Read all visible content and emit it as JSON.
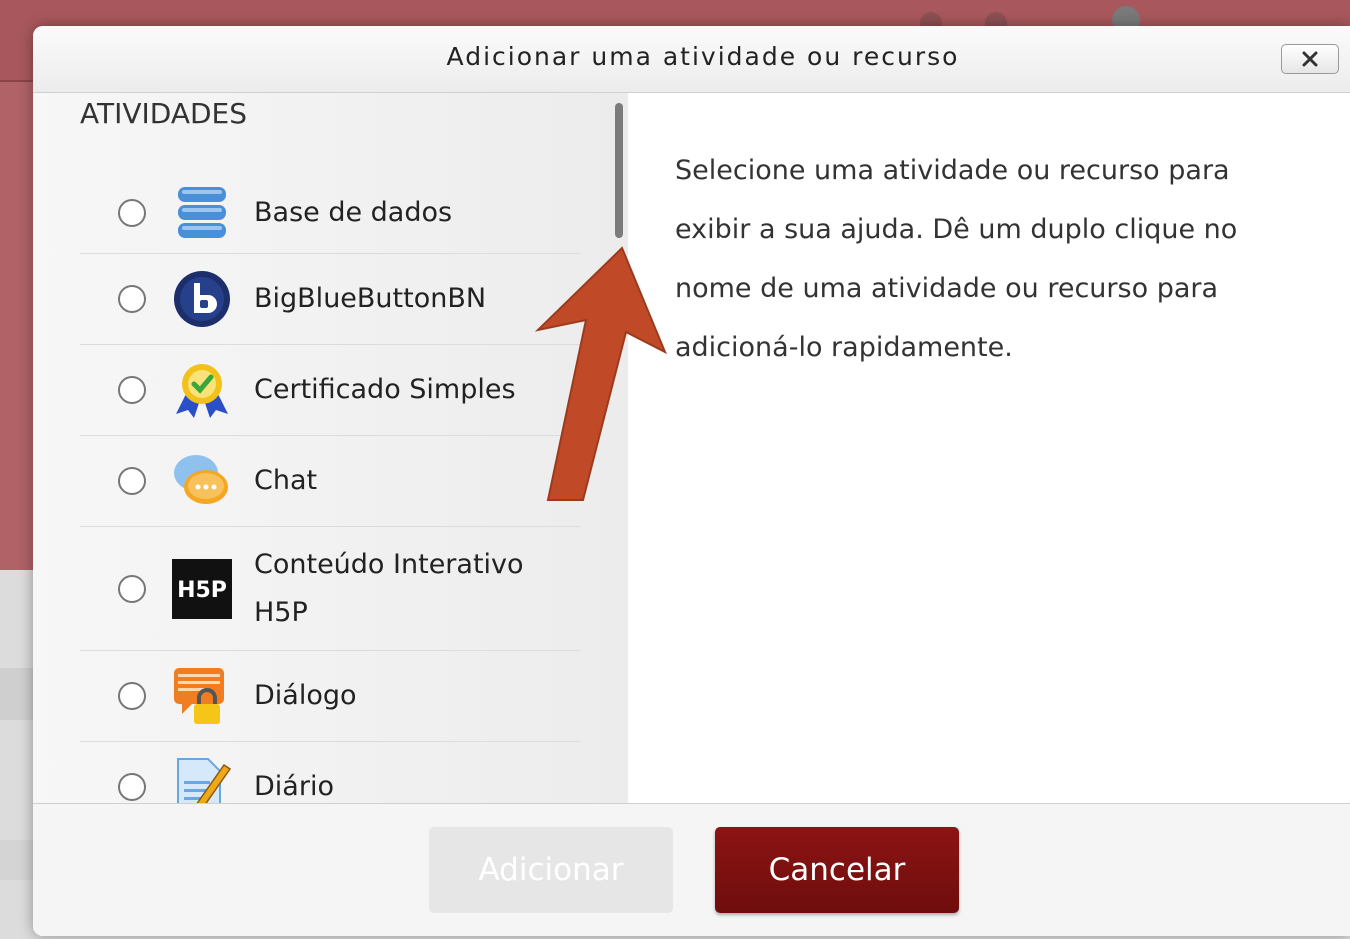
{
  "dialog": {
    "title": "Adicionar uma atividade ou recurso",
    "close_icon": "close-icon"
  },
  "activities": {
    "section_title": "ATIVIDADES",
    "items": [
      {
        "label": "Base de dados",
        "icon": "database-icon"
      },
      {
        "label": "BigBlueButtonBN",
        "icon": "bigbluebutton-icon"
      },
      {
        "label": "Certificado Simples",
        "icon": "certificate-icon"
      },
      {
        "label": "Chat",
        "icon": "chat-icon"
      },
      {
        "label": "Conteúdo Interativo H5P",
        "icon": "h5p-icon"
      },
      {
        "label": "Diálogo",
        "icon": "dialogue-icon"
      },
      {
        "label": "Diário",
        "icon": "journal-icon"
      }
    ]
  },
  "help": {
    "text": "Selecione uma atividade ou recurso para exibir a sua ajuda. Dê um duplo clique no nome de uma atividade ou recurso para adicioná-lo rapidamente."
  },
  "footer": {
    "add_label": "Adicionar",
    "cancel_label": "Cancelar"
  },
  "colors": {
    "accent": "#7d1111",
    "theme": "#b06267",
    "arrow": "#c04a28"
  }
}
